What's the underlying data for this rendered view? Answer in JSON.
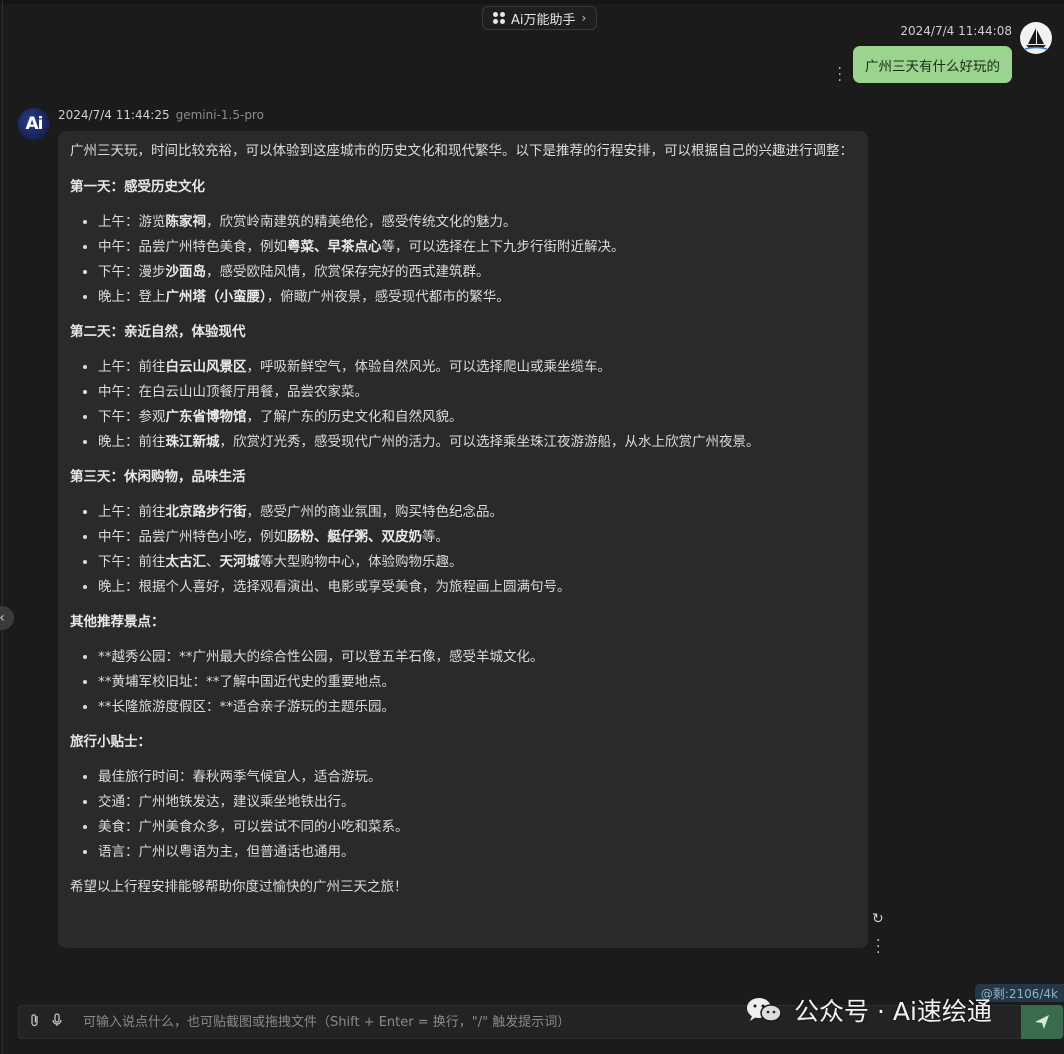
{
  "header": {
    "assistant_name": "Ai万能助手"
  },
  "user_message": {
    "timestamp": "2024/7/4 11:44:08",
    "text": "广州三天有什么好玩的"
  },
  "ai_message": {
    "avatar_text": "Ai",
    "timestamp": "2024/7/4 11:44:25",
    "model": "gemini-1.5-pro",
    "intro": "广州三天玩，时间比较充裕，可以体验到这座城市的历史文化和现代繁华。以下是推荐的行程安排，可以根据自己的兴趣进行调整：",
    "sections": [
      {
        "title": "第一天：感受历史文化",
        "items": [
          {
            "pre": "上午：游览",
            "b1": "陈家祠",
            "mid": "，欣赏岭南建筑的精美绝伦，感受传统文化的魅力。",
            "b2": "",
            "post": ""
          },
          {
            "pre": "中午：品尝广州特色美食，例如",
            "b1": "粤菜、早茶点心",
            "mid": "等，可以选择在上下九步行街附近解决。",
            "b2": "",
            "post": ""
          },
          {
            "pre": "下午：漫步",
            "b1": "沙面岛",
            "mid": "，感受欧陆风情，欣赏保存完好的西式建筑群。",
            "b2": "",
            "post": ""
          },
          {
            "pre": "晚上：登上",
            "b1": "广州塔（小蛮腰）",
            "mid": "，俯瞰广州夜景，感受现代都市的繁华。",
            "b2": "",
            "post": ""
          }
        ]
      },
      {
        "title": "第二天：亲近自然，体验现代",
        "items": [
          {
            "pre": "上午：前往",
            "b1": "白云山风景区",
            "mid": "，呼吸新鲜空气，体验自然风光。可以选择爬山或乘坐缆车。",
            "b2": "",
            "post": ""
          },
          {
            "pre": "中午：在白云山山顶餐厅用餐，品尝农家菜。",
            "b1": "",
            "mid": "",
            "b2": "",
            "post": ""
          },
          {
            "pre": "下午：参观",
            "b1": "广东省博物馆",
            "mid": "，了解广东的历史文化和自然风貌。",
            "b2": "",
            "post": ""
          },
          {
            "pre": "晚上：前往",
            "b1": "珠江新城",
            "mid": "，欣赏灯光秀，感受现代广州的活力。可以选择乘坐珠江夜游游船，从水上欣赏广州夜景。",
            "b2": "",
            "post": ""
          }
        ]
      },
      {
        "title": "第三天：休闲购物，品味生活",
        "items": [
          {
            "pre": "上午：前往",
            "b1": "北京路步行街",
            "mid": "，感受广州的商业氛围，购买特色纪念品。",
            "b2": "",
            "post": ""
          },
          {
            "pre": "中午：品尝广州特色小吃，例如",
            "b1": "肠粉、艇仔粥、双皮奶",
            "mid": "等。",
            "b2": "",
            "post": ""
          },
          {
            "pre": "下午：前往",
            "b1": "太古汇",
            "mid": "、",
            "b2": "天河城",
            "post": "等大型购物中心，体验购物乐趣。"
          },
          {
            "pre": "晚上：根据个人喜好，选择观看演出、电影或享受美食，为旅程画上圆满句号。",
            "b1": "",
            "mid": "",
            "b2": "",
            "post": ""
          }
        ]
      },
      {
        "title": "其他推荐景点：",
        "items": [
          {
            "pre": "**越秀公园：**广州最大的综合性公园，可以登五羊石像，感受羊城文化。",
            "b1": "",
            "mid": "",
            "b2": "",
            "post": ""
          },
          {
            "pre": "**黄埔军校旧址：**了解中国近代史的重要地点。",
            "b1": "",
            "mid": "",
            "b2": "",
            "post": ""
          },
          {
            "pre": "**长隆旅游度假区：**适合亲子游玩的主题乐园。",
            "b1": "",
            "mid": "",
            "b2": "",
            "post": ""
          }
        ]
      },
      {
        "title": "旅行小贴士：",
        "items": [
          {
            "pre": "最佳旅行时间：春秋两季气候宜人，适合游玩。",
            "b1": "",
            "mid": "",
            "b2": "",
            "post": ""
          },
          {
            "pre": "交通：广州地铁发达，建议乘坐地铁出行。",
            "b1": "",
            "mid": "",
            "b2": "",
            "post": ""
          },
          {
            "pre": "美食：广州美食众多，可以尝试不同的小吃和菜系。",
            "b1": "",
            "mid": "",
            "b2": "",
            "post": ""
          },
          {
            "pre": "语言：广州以粤语为主，但普通话也通用。",
            "b1": "",
            "mid": "",
            "b2": "",
            "post": ""
          }
        ]
      }
    ],
    "closing": "希望以上行程安排能够帮助你度过愉快的广州三天之旅！"
  },
  "input": {
    "placeholder": "可输入说点什么，也可贴截图或拖拽文件（Shift + Enter = 换行，\"/\" 触发提示词）",
    "token_badge": "@剩:2106/4k"
  },
  "watermark": {
    "text": "公众号 · Ai速绘通"
  },
  "icons": {
    "assistant": "grid-icon",
    "chevron": "chevron-right-icon",
    "user_avatar": "sailboat-icon",
    "more": "more-vertical-icon",
    "refresh": "refresh-icon",
    "attach": "paperclip-icon",
    "mic": "microphone-icon",
    "send": "send-icon",
    "collapse": "chevron-left-icon",
    "wechat": "wechat-icon"
  },
  "colors": {
    "background": "#1b1b1b",
    "ai_bubble": "#2a2a2a",
    "user_bubble": "#9ad48f",
    "send_button": "#3a6b4d"
  }
}
